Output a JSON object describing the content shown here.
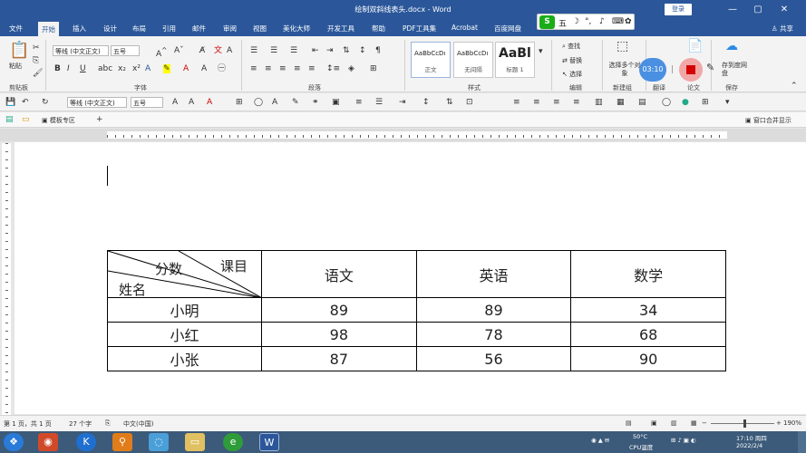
{
  "titlebar": {
    "title": "绘制双斜线表头.docx - Word",
    "login": "登录",
    "minimize": "—",
    "restore": "▢",
    "close": "✕"
  },
  "tabs": [
    "文件",
    "开始",
    "插入",
    "设计",
    "布局",
    "引用",
    "邮件",
    "审阅",
    "视图",
    "美化大师",
    "开发工具",
    "帮助",
    "PDF工具集",
    "Acrobat",
    "百度网盘"
  ],
  "share": "共享",
  "ribbon": {
    "paste": "粘贴",
    "clipboard": "剪贴板",
    "font_name": "等线 (中文正文)",
    "font_size": "五号",
    "font_group": "字体",
    "paragraph_group": "段落",
    "styles_group": "样式",
    "styles": [
      {
        "sample": "AaBbCcDı",
        "name": "正文"
      },
      {
        "sample": "AaBbCcDı",
        "name": "无间隔"
      },
      {
        "sample": "AaBl",
        "name": "标题 1"
      }
    ],
    "edit_find": "查找",
    "edit_replace": "替换",
    "edit_select": "选择",
    "edit_group": "编辑",
    "select_multi": "选择多个对象",
    "new_group": "新建组",
    "translate_group": "翻译",
    "paper_group": "论文",
    "save_label": "保存",
    "save_to": "存到度网盘"
  },
  "ime": {
    "logo": "S",
    "mode": "五"
  },
  "recorder": {
    "timer": "03:10"
  },
  "qat": {
    "font_name": "等线 (中文正文)",
    "font_size": "五号"
  },
  "doc_tabs": {
    "tab": "模板专区",
    "add": "+",
    "window": "窗口合并显示"
  },
  "table": {
    "corner": {
      "top_right": "课目",
      "middle": "分数",
      "bottom_left": "姓名"
    },
    "headers": [
      "语文",
      "英语",
      "数学"
    ],
    "rows": [
      {
        "name": "小明",
        "scores": [
          "89",
          "89",
          "34"
        ]
      },
      {
        "name": "小红",
        "scores": [
          "98",
          "78",
          "68"
        ]
      },
      {
        "name": "小张",
        "scores": [
          "87",
          "56",
          "90"
        ]
      }
    ]
  },
  "status": {
    "page": "第 1 页，共 1 页",
    "words": "27 个字",
    "lang": "中文(中国)",
    "zoom": "190%"
  },
  "taskbar": {
    "temp": "50°C",
    "cpu": "CPU温度",
    "time": "17:10 周四",
    "date": "2022/2/4"
  }
}
